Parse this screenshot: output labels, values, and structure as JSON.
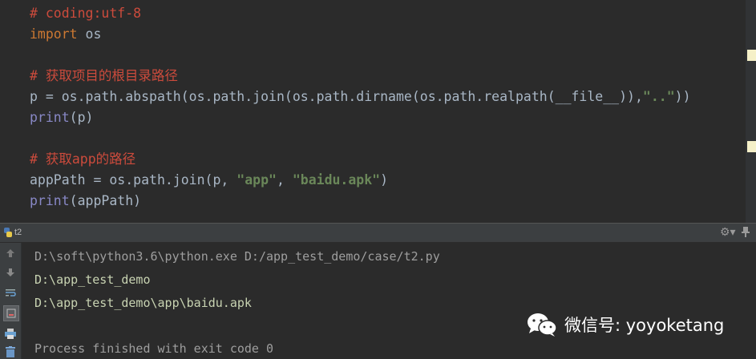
{
  "editor": {
    "lines": [
      {
        "text": "# coding:utf-8"
      },
      {
        "kw": "import",
        "rest": " os"
      },
      {
        "text": ""
      },
      {
        "text": "# 获取项目的根目录路径"
      },
      {
        "p1": "p = os.path.abspath(os.path.join(os.path.dirname(os.path.realpath(__file__)),",
        "str": "\"..\"",
        "p2": "))"
      },
      {
        "bi": "print",
        "rest": "(p)"
      },
      {
        "text": ""
      },
      {
        "text": "# 获取app的路径"
      },
      {
        "p1": "appPath = os.path.join(p, ",
        "s1": "\"app\"",
        "mid": ", ",
        "s2": "\"baidu.apk\"",
        "p2": ")"
      },
      {
        "bi": "print",
        "rest": "(appPath)"
      }
    ]
  },
  "run_panel": {
    "tab_label": "t2",
    "tab_icon": "python-icon",
    "settings_icon": "gear-icon",
    "pin_icon": "pin-icon"
  },
  "toolbar": {
    "icons": [
      "arrow-up-icon",
      "arrow-down-icon",
      "soft-wrap-icon",
      "scroll-to-end-icon",
      "print-icon",
      "trash-icon"
    ]
  },
  "console": {
    "command": "D:\\soft\\python3.6\\python.exe D:/app_test_demo/case/t2.py",
    "output1": "D:\\app_test_demo",
    "output2": "D:\\app_test_demo\\app\\baidu.apk",
    "finished": "Process finished with exit code 0"
  },
  "watermark": {
    "text": "微信号: yoyoketang",
    "icon": "wechat-icon"
  },
  "colors": {
    "editor_bg": "#2b2b2b",
    "comment": "#cc4b3c",
    "keyword": "#cc7832",
    "builtin": "#8888c6",
    "string": "#6a8759",
    "code": "#a9b7c6",
    "marker": "#f5f0c8"
  }
}
